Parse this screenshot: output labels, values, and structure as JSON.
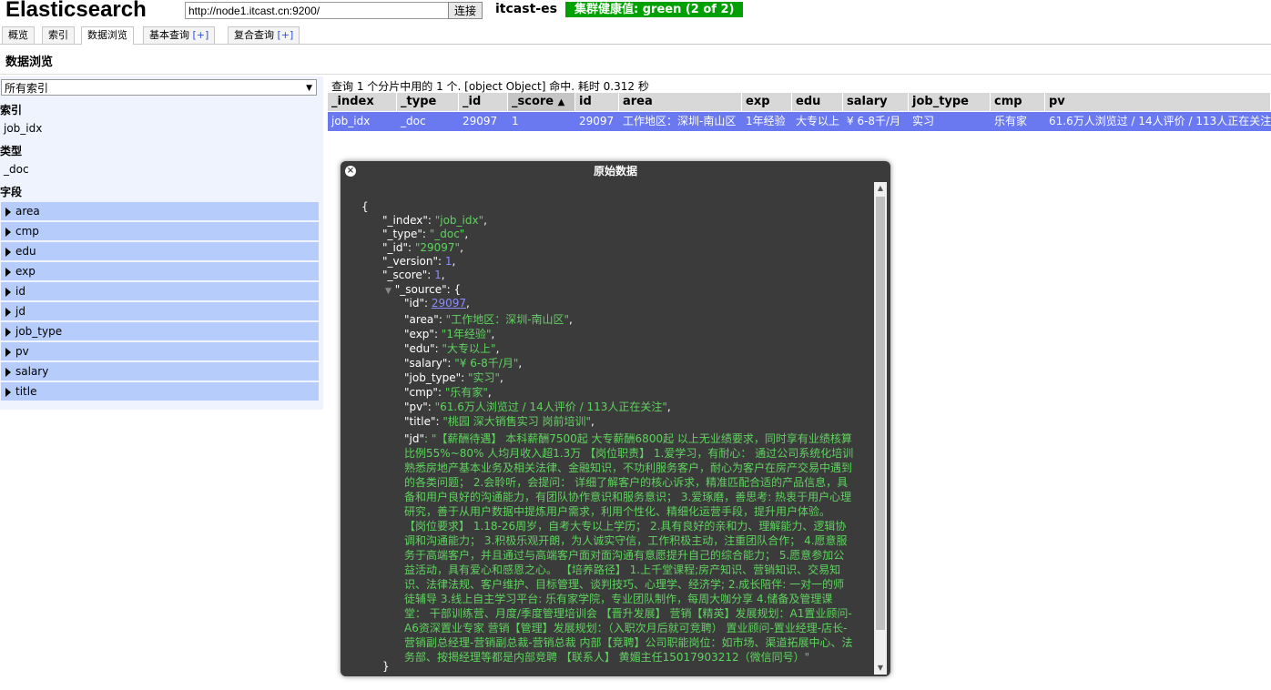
{
  "header": {
    "title": "Elasticsearch",
    "url_value": "http://node1.itcast.cn:9200/",
    "connect_label": "连接",
    "cluster_name": "itcast-es",
    "health_text": "集群健康值: green (2 of 2)",
    "health_color": "#00a000"
  },
  "tabs": [
    {
      "label": "概览"
    },
    {
      "label": "索引"
    },
    {
      "label": "数据浏览"
    },
    {
      "label": "基本查询",
      "plus": "[+]"
    },
    {
      "label": "复合查询",
      "plus": "[+]"
    }
  ],
  "section_title": "数据浏览",
  "sidebar": {
    "select_value": "所有索引",
    "index_heading": "索引",
    "index_item": "job_idx",
    "type_heading": "类型",
    "type_item": "_doc",
    "field_heading": "字段",
    "fields": [
      "area",
      "cmp",
      "edu",
      "exp",
      "id",
      "jd",
      "job_type",
      "pv",
      "salary",
      "title"
    ]
  },
  "query_info": "查询 1 个分片中用的 1 个. [object Object] 命中. 耗时 0.312 秒",
  "table": {
    "columns": [
      "_index",
      "_type",
      "_id",
      "_score",
      "id",
      "area",
      "exp",
      "edu",
      "salary",
      "job_type",
      "cmp",
      "pv"
    ],
    "sort_indicator": "▲",
    "row": [
      "job_idx",
      "_doc",
      "29097",
      "1",
      "29097",
      "工作地区：深圳-南山区",
      "1年经验",
      "大专以上",
      "¥ 6-8千/月",
      "实习",
      "乐有家",
      "61.6万人浏览过 / 14人评价 / 113人正在关注"
    ]
  },
  "dialog": {
    "title": "原始数据",
    "close_label": "×",
    "json": {
      "open_brace": "{",
      "index_key": "\"_index\"",
      "index_val": "\"job_idx\"",
      "type_key": "\"_type\"",
      "type_val": "\"_doc\"",
      "id_key": "\"_id\"",
      "id_val": "\"29097\"",
      "version_key": "\"_version\"",
      "version_val": "1",
      "score_key": "\"_score\"",
      "score_val": "1",
      "source_key": "\"_source\"",
      "src_id_key": "\"id\"",
      "src_id_val": "29097",
      "area_key": "\"area\"",
      "area_val": "\"工作地区：深圳-南山区\"",
      "exp_key": "\"exp\"",
      "exp_val": "\"1年经验\"",
      "edu_key": "\"edu\"",
      "edu_val": "\"大专以上\"",
      "salary_key": "\"salary\"",
      "salary_val": "\"¥ 6-8千/月\"",
      "jobtype_key": "\"job_type\"",
      "jobtype_val": "\"实习\"",
      "cmp_key": "\"cmp\"",
      "cmp_val": "\"乐有家\"",
      "pv_key": "\"pv\"",
      "pv_val": "\"61.6万人浏览过 / 14人评价 / 113人正在关注\"",
      "title_key": "\"title\"",
      "title_val": "\"桃园 深大销售实习 岗前培训\"",
      "jd_key": "\"jd\"",
      "jd_val": "\"【薪酬待遇】 本科薪酬7500起 大专薪酬6800起 以上无业绩要求，同时享有业绩核算比例55%~80% 人均月收入超1.3万 【岗位职责】 1.爱学习，有耐心： 通过公司系统化培训熟悉房地产基本业务及相关法律、金融知识，不功利服务客户，耐心为客户在房产交易中遇到的各类问题； 2.会聆听，会提问： 详细了解客户的核心诉求，精准匹配合适的产品信息，具备和用户良好的沟通能力，有团队协作意识和服务意识； 3.爱琢磨，善思考: 热衷于用户心理研究，善于从用户数据中提炼用户需求，利用个性化、精细化运营手段，提升用户体验。 【岗位要求】 1.18-26周岁，自考大专以上学历； 2.具有良好的亲和力、理解能力、逻辑协调和沟通能力； 3.积极乐观开朗，为人诚实守信，工作积极主动，注重团队合作； 4.愿意服务于高端客户，并且通过与高端客户面对面沟通有意愿提升自己的综合能力； 5.愿意参加公益活动，具有爱心和感恩之心。 【培养路径】 1.上千堂课程;房产知识、营销知识、交易知识、法律法规、客户维护、目标管理、谈判技巧、心理学、经济学; 2.成长陪伴: 一对一的师徒辅导 3.线上自主学习平台: 乐有家学院，专业团队制作，每周大咖分享 4.储备及管理课堂： 干部训练营、月度/季度管理培训会 【晋升发展】 营销【精英】发展规划：A1置业顾问-A6资深置业专家 营销【管理】发展规划：（入职次月后就可竞聘） 置业顾问-置业经理-店长-营销副总经理-营销副总裁-营销总裁 内部【竞聘】公司职能岗位：如市场、渠道拓展中心、法务部、按揭经理等都是内部竞聘 【联系人】 黄媚主任15017903212（微信同号）\"",
      "close_brace": "}"
    }
  }
}
